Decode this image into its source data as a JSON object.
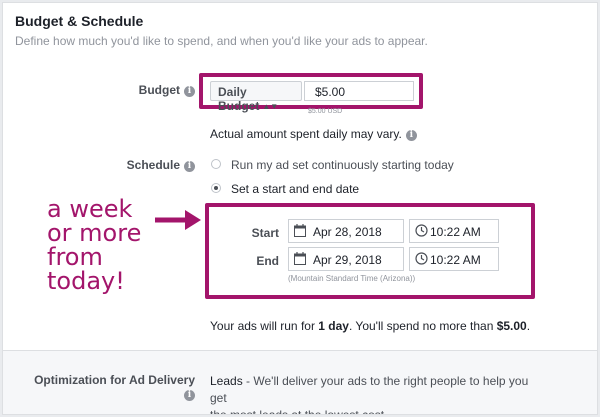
{
  "section": {
    "title": "Budget & Schedule",
    "subtitle": "Define how much you'd like to spend, and when you'd like your ads to appear."
  },
  "budget": {
    "label": "Budget",
    "type_selected": "Daily Budget",
    "amount": "$5.00",
    "currency_note": "$5.00 USD",
    "hint": "Actual amount spent daily may vary."
  },
  "schedule": {
    "label": "Schedule",
    "option_continuous": "Run my ad set continuously starting today",
    "option_start_end": "Set a start and end date",
    "selected": "start_end",
    "start_label": "Start",
    "start_date": "Apr 28, 2018",
    "start_time": "10:22 AM",
    "end_label": "End",
    "end_date": "Apr 29, 2018",
    "end_time": "10:22 AM",
    "timezone": "(Mountain Standard Time (Arizona))",
    "summary_prefix": "Your ads will run for ",
    "summary_duration": "1 day",
    "summary_mid": ". You'll spend no more than ",
    "summary_amount": "$5.00",
    "summary_suffix": "."
  },
  "annotation": {
    "line1": "a week",
    "line2": "or more",
    "line3": "from",
    "line4": "today!",
    "color": "#a3156b"
  },
  "optimization": {
    "label": "Optimization for Ad Delivery",
    "value": "Leads",
    "description_line1": " - We'll deliver your ads to the right people to help you get",
    "description_line2": "the most leads at the lowest cost."
  },
  "icons": {
    "info": "info-icon",
    "calendar": "calendar-icon",
    "clock": "clock-icon",
    "arrow": "arrow-right-icon"
  }
}
